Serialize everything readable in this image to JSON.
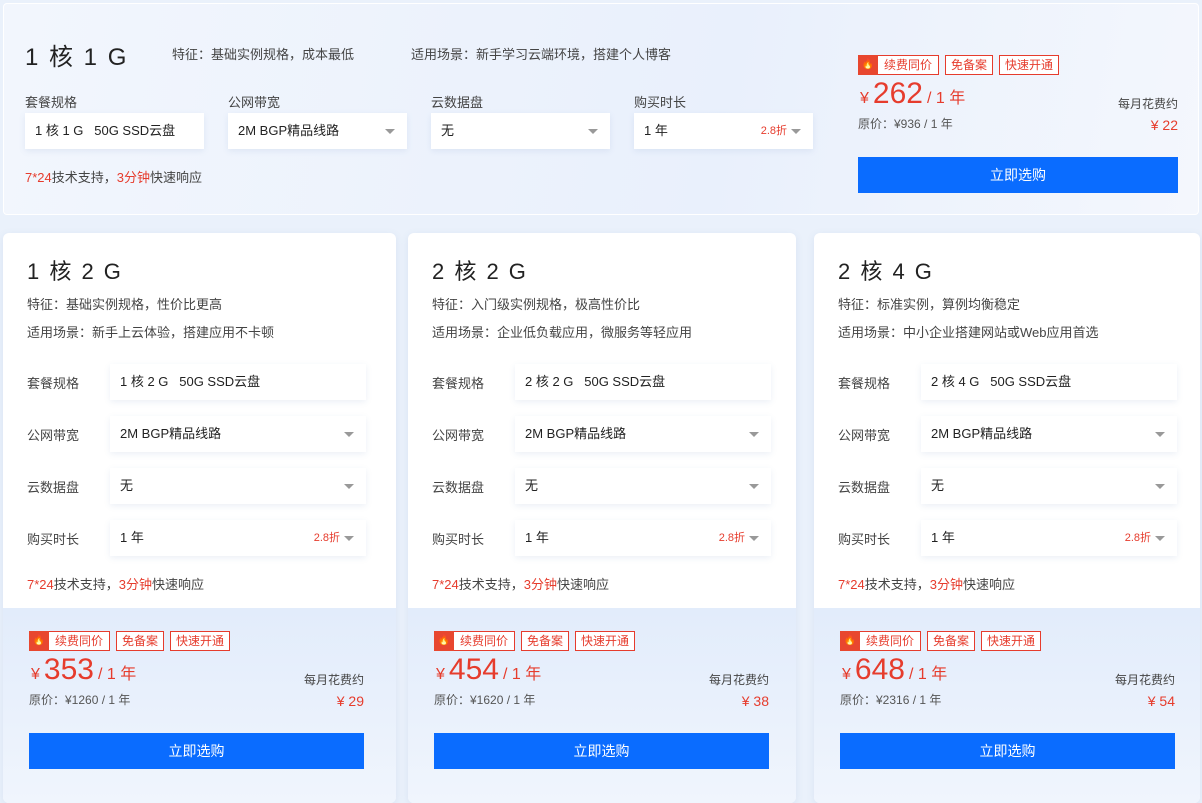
{
  "top": {
    "title": "1 核 1 G",
    "feature": "特征：基础实例规格，成本最低",
    "scene": "适用场景：新手学习云端环境，搭建个人博客",
    "labels": [
      "套餐规格",
      "公网带宽",
      "云数据盘",
      "购买时长"
    ],
    "spec": "1 核 1 G   50G SSD云盘",
    "bandwidth": "2M BGP精品线路",
    "disk": "无",
    "duration": "1 年",
    "discount": "2.8折",
    "support_a": "7*24",
    "support_b": "技术支持，",
    "support_c": "3分钟",
    "support_d": "快速响应",
    "tags": [
      "续费同价",
      "免备案",
      "快速开通"
    ],
    "currency": "¥",
    "price": "262",
    "per": "/ 1 年",
    "orig": "原价：¥936 / 1 年",
    "monthly_label": "每月花费约",
    "monthly": "¥ 22",
    "buy": "立即选购"
  },
  "cards": [
    {
      "title": "1 核 2 G",
      "feature": "特征：基础实例规格，性价比更高",
      "scene": "适用场景：新手上云体验，搭建应用不卡顿",
      "labels": [
        "套餐规格",
        "公网带宽",
        "云数据盘",
        "购买时长"
      ],
      "spec": "1 核 2 G   50G SSD云盘",
      "bandwidth": "2M BGP精品线路",
      "disk": "无",
      "duration": "1 年",
      "discount": "2.8折",
      "support_a": "7*24",
      "support_b": "技术支持，",
      "support_c": "3分钟",
      "support_d": "快速响应",
      "tags": [
        "续费同价",
        "免备案",
        "快速开通"
      ],
      "currency": "¥",
      "price": "353",
      "per": "/ 1 年",
      "orig": "原价：¥1260 / 1 年",
      "monthly_label": "每月花费约",
      "monthly": "¥ 29",
      "buy": "立即选购"
    },
    {
      "title": "2 核 2 G",
      "feature": "特征：入门级实例规格，极高性价比",
      "scene": "适用场景：企业低负载应用，微服务等轻应用",
      "labels": [
        "套餐规格",
        "公网带宽",
        "云数据盘",
        "购买时长"
      ],
      "spec": "2 核 2 G   50G SSD云盘",
      "bandwidth": "2M BGP精品线路",
      "disk": "无",
      "duration": "1 年",
      "discount": "2.8折",
      "support_a": "7*24",
      "support_b": "技术支持，",
      "support_c": "3分钟",
      "support_d": "快速响应",
      "tags": [
        "续费同价",
        "免备案",
        "快速开通"
      ],
      "currency": "¥",
      "price": "454",
      "per": "/ 1 年",
      "orig": "原价：¥1620 / 1 年",
      "monthly_label": "每月花费约",
      "monthly": "¥ 38",
      "buy": "立即选购"
    },
    {
      "title": "2 核 4 G",
      "feature": "特征：标准实例，算例均衡稳定",
      "scene": "适用场景：中小企业搭建网站或Web应用首选",
      "labels": [
        "套餐规格",
        "公网带宽",
        "云数据盘",
        "购买时长"
      ],
      "spec": "2 核 4 G   50G SSD云盘",
      "bandwidth": "2M BGP精品线路",
      "disk": "无",
      "duration": "1 年",
      "discount": "2.8折",
      "support_a": "7*24",
      "support_b": "技术支持，",
      "support_c": "3分钟",
      "support_d": "快速响应",
      "tags": [
        "续费同价",
        "免备案",
        "快速开通"
      ],
      "currency": "¥",
      "price": "648",
      "per": "/ 1 年",
      "orig": "原价：¥2316 / 1 年",
      "monthly_label": "每月花费约",
      "monthly": "¥ 54",
      "buy": "立即选购"
    }
  ]
}
